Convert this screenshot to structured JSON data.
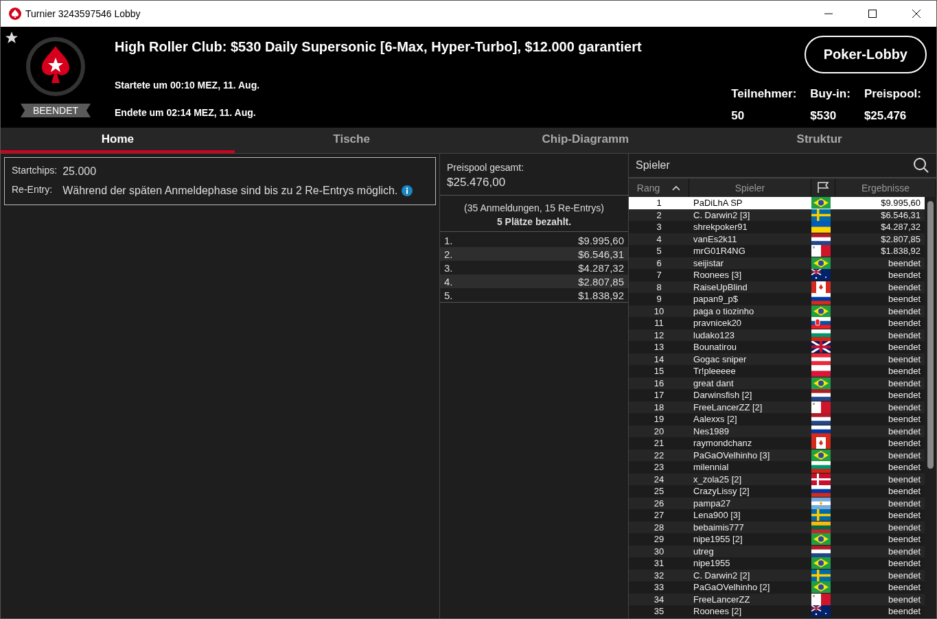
{
  "window": {
    "title": "Turnier 3243597546 Lobby"
  },
  "header": {
    "favorite": true,
    "status": "BEENDET",
    "title": "High Roller Club: $530 Daily Supersonic [6-Max, Hyper-Turbo], $12.000 garantiert",
    "started": "Startete um 00:10 MEZ, 11. Aug.",
    "ended": "Endete um 02:14 MEZ, 11. Aug.",
    "lobby_button": "Poker-Lobby",
    "stats": [
      {
        "label": "Teilnehmer:",
        "value": "50"
      },
      {
        "label": "Buy-in:",
        "value": "$530"
      },
      {
        "label": "Preispool:",
        "value": "$25.476"
      }
    ]
  },
  "tabs": [
    {
      "label": "Home",
      "selected": true
    },
    {
      "label": "Tische",
      "selected": false
    },
    {
      "label": "Chip-Diagramm",
      "selected": false
    },
    {
      "label": "Struktur",
      "selected": false
    }
  ],
  "info": [
    {
      "label": "Startchips:",
      "value": "25.000",
      "info_icon": false
    },
    {
      "label": "Re-Entry:",
      "value": "Während der späten Anmeldephase sind bis zu 2 Re-Entrys möglich.",
      "info_icon": true
    }
  ],
  "prizes": {
    "label": "Preispool gesamt:",
    "total": "$25.476,00",
    "entries": "(35 Anmeldungen, 15 Re-Entrys)",
    "paid": "5 Plätze bezahlt.",
    "places": [
      {
        "place": "1.",
        "amount": "$9.995,60"
      },
      {
        "place": "2.",
        "amount": "$6.546,31"
      },
      {
        "place": "3.",
        "amount": "$4.287,32"
      },
      {
        "place": "4.",
        "amount": "$2.807,85"
      },
      {
        "place": "5.",
        "amount": "$1.838,92"
      }
    ]
  },
  "players": {
    "title": "Spieler",
    "columns": [
      "Rang",
      "Spieler",
      "Ergebnisse"
    ],
    "rows": [
      {
        "rank": "1",
        "name": "PaDiLhA SP",
        "kind": "br",
        "result": "$9.995,60",
        "selected": true
      },
      {
        "rank": "2",
        "name": "C. Darwin2 [3]",
        "kind": "se",
        "result": "$6.546,31",
        "selected": false
      },
      {
        "rank": "3",
        "name": "shrekpoker91",
        "kind": "ua",
        "result": "$4.287,32",
        "selected": false
      },
      {
        "rank": "4",
        "name": "vanEs2k11",
        "kind": "nl",
        "result": "$2.807,85",
        "selected": false
      },
      {
        "rank": "5",
        "name": "mrG01R4NG",
        "kind": "mt",
        "result": "$1.838,92",
        "selected": false
      },
      {
        "rank": "6",
        "name": "seijistar",
        "kind": "br",
        "result": "beendet",
        "selected": false
      },
      {
        "rank": "7",
        "name": "Roonees [3]",
        "kind": "au",
        "result": "beendet",
        "selected": false
      },
      {
        "rank": "8",
        "name": "RaiseUpBlind",
        "kind": "ca",
        "result": "beendet",
        "selected": false
      },
      {
        "rank": "9",
        "name": "papan9_p$",
        "kind": "ru",
        "result": "beendet",
        "selected": false
      },
      {
        "rank": "10",
        "name": "paga o tiozinho",
        "kind": "br",
        "result": "beendet",
        "selected": false
      },
      {
        "rank": "11",
        "name": "pravnicek20",
        "kind": "sk",
        "result": "beendet",
        "selected": false
      },
      {
        "rank": "12",
        "name": "ludako123",
        "kind": "bg",
        "result": "beendet",
        "selected": false
      },
      {
        "rank": "13",
        "name": "Bounatirou",
        "kind": "gb",
        "result": "beendet",
        "selected": false
      },
      {
        "rank": "14",
        "name": "Gogac sniper",
        "kind": "at",
        "result": "beendet",
        "selected": false
      },
      {
        "rank": "15",
        "name": "Tr!pleeeee",
        "kind": "pl",
        "result": "beendet",
        "selected": false
      },
      {
        "rank": "16",
        "name": "great dant",
        "kind": "br",
        "result": "beendet",
        "selected": false
      },
      {
        "rank": "17",
        "name": "Darwinsfish [2]",
        "kind": "nl",
        "result": "beendet",
        "selected": false
      },
      {
        "rank": "18",
        "name": "FreeLancerZZ [2]",
        "kind": "mt",
        "result": "beendet",
        "selected": false
      },
      {
        "rank": "19",
        "name": "Aalexxs [2]",
        "kind": "nl",
        "result": "beendet",
        "selected": false
      },
      {
        "rank": "20",
        "name": "Nes1989",
        "kind": "ru",
        "result": "beendet",
        "selected": false
      },
      {
        "rank": "21",
        "name": "raymondchanz",
        "kind": "ca",
        "result": "beendet",
        "selected": false
      },
      {
        "rank": "22",
        "name": "PaGaOVelhinho [3]",
        "kind": "br",
        "result": "beendet",
        "selected": false
      },
      {
        "rank": "23",
        "name": "milennial",
        "kind": "bg",
        "result": "beendet",
        "selected": false
      },
      {
        "rank": "24",
        "name": "x_zola25 [2]",
        "kind": "dk",
        "result": "beendet",
        "selected": false
      },
      {
        "rank": "25",
        "name": "CrazyLissy [2]",
        "kind": "ru",
        "result": "beendet",
        "selected": false
      },
      {
        "rank": "26",
        "name": "pampa27",
        "kind": "ar",
        "result": "beendet",
        "selected": false
      },
      {
        "rank": "27",
        "name": "Lena900 [3]",
        "kind": "se",
        "result": "beendet",
        "selected": false
      },
      {
        "rank": "28",
        "name": "bebaimis777",
        "kind": "lt",
        "result": "beendet",
        "selected": false
      },
      {
        "rank": "29",
        "name": "nipe1955 [2]",
        "kind": "br",
        "result": "beendet",
        "selected": false
      },
      {
        "rank": "30",
        "name": "utreg",
        "kind": "nl",
        "result": "beendet",
        "selected": false
      },
      {
        "rank": "31",
        "name": "nipe1955",
        "kind": "br",
        "result": "beendet",
        "selected": false
      },
      {
        "rank": "32",
        "name": "C. Darwin2 [2]",
        "kind": "se",
        "result": "beendet",
        "selected": false
      },
      {
        "rank": "33",
        "name": "PaGaOVelhinho [2]",
        "kind": "br",
        "result": "beendet",
        "selected": false
      },
      {
        "rank": "34",
        "name": "FreeLancerZZ",
        "kind": "mt",
        "result": "beendet",
        "selected": false
      },
      {
        "rank": "35",
        "name": "Roonees [2]",
        "kind": "au",
        "result": "beendet",
        "selected": false
      }
    ]
  }
}
